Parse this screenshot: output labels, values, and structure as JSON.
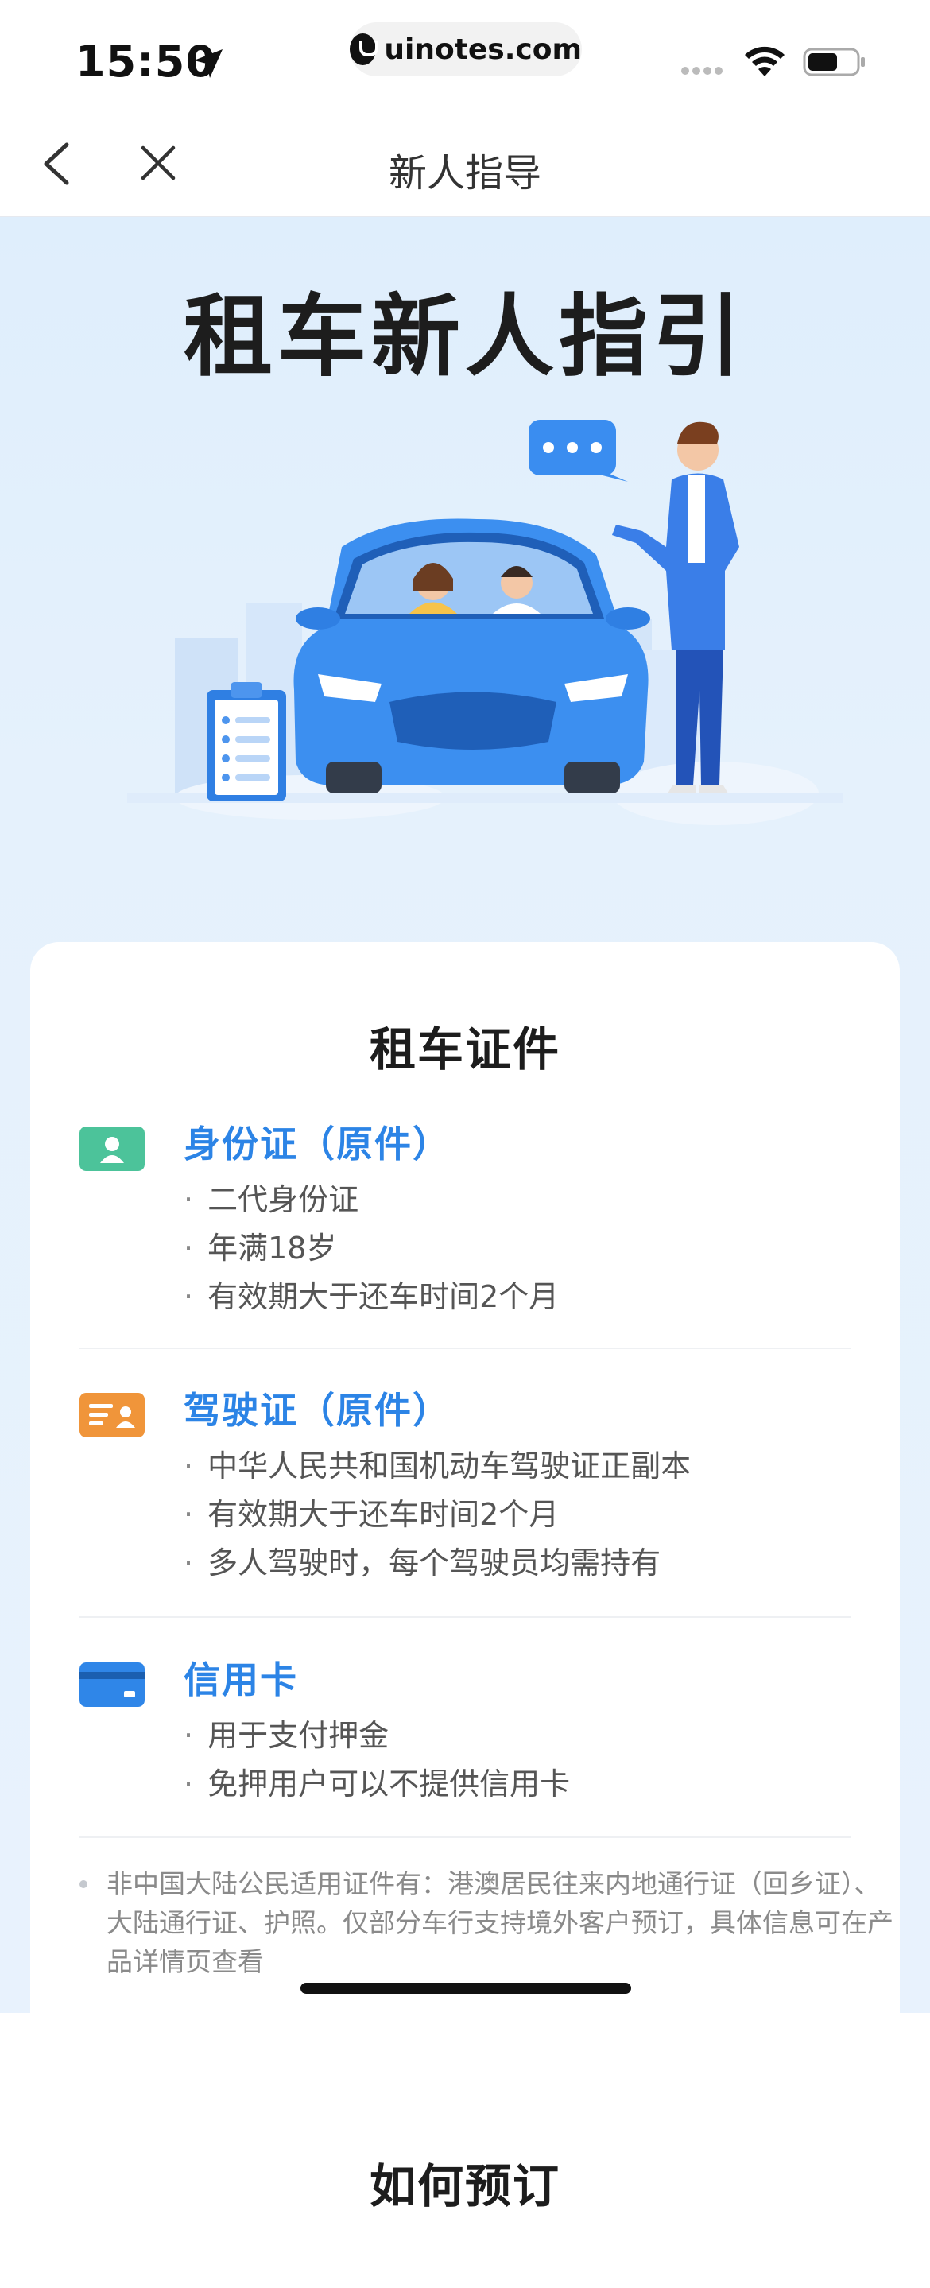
{
  "status_bar": {
    "time": "15:50",
    "url": "uinotes.com"
  },
  "nav": {
    "title": "新人指导",
    "back_icon": "chevron-left-icon",
    "close_icon": "close-icon"
  },
  "hero": {
    "title": "租车新人指引"
  },
  "documents_card": {
    "title": "租车证件",
    "sections": [
      {
        "icon": "id-card-icon",
        "icon_color": "#4cc39a",
        "heading": "身份证（原件）",
        "items": [
          "二代身份证",
          "年满18岁",
          "有效期大于还车时间2个月"
        ]
      },
      {
        "icon": "driver-license-icon",
        "icon_color": "#f0953a",
        "heading": "驾驶证（原件）",
        "items": [
          "中华人民共和国机动车驾驶证正副本",
          "有效期大于还车时间2个月",
          "多人驾驶时，每个驾驶员均需持有"
        ]
      },
      {
        "icon": "credit-card-icon",
        "icon_color": "#2f86e8",
        "heading": "信用卡",
        "items": [
          "用于支付押金",
          "免押用户可以不提供信用卡"
        ]
      }
    ],
    "note": "非中国大陆公民适用证件有：港澳居民往来内地通行证（回乡证）、大陆通行证、护照。仅部分车行支持境外客户预订，具体信息可在产品详情页查看"
  },
  "booking_card": {
    "title": "如何预订"
  },
  "colors": {
    "accent_blue": "#2c84e6",
    "highlight_yellow": "#f9dc8b",
    "hero_bg": "#dfeefc"
  }
}
